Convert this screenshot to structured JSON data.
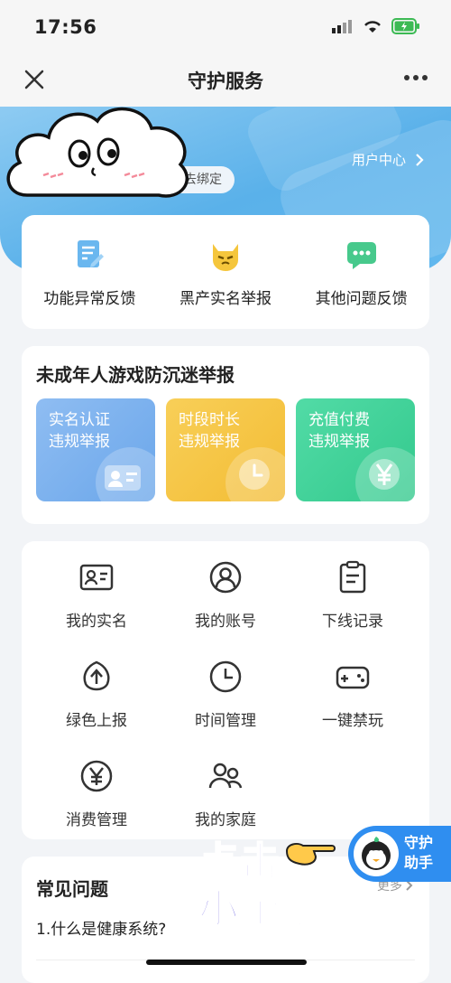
{
  "status": {
    "time": "17:56"
  },
  "nav": {
    "title": "守护服务"
  },
  "banner": {
    "user_center": "用户中心",
    "bind_label": "去绑定"
  },
  "feedback": [
    {
      "label": "功能异常反馈",
      "icon": "doc-edit-icon"
    },
    {
      "label": "黑产实名举报",
      "icon": "cat-face-icon"
    },
    {
      "label": "其他问题反馈",
      "icon": "chat-bubble-icon"
    }
  ],
  "minor": {
    "title": "未成年人游戏防沉迷举报",
    "tiles": [
      {
        "line1": "实名认证",
        "line2": "违规举报",
        "color": "#7fb3ee"
      },
      {
        "line1": "时段时长",
        "line2": "违规举报",
        "color": "#f6c54a"
      },
      {
        "line1": "充值付费",
        "line2": "违规举报",
        "color": "#3fd39a"
      }
    ]
  },
  "grid": [
    {
      "label": "我的实名",
      "icon": "id-card-icon"
    },
    {
      "label": "我的账号",
      "icon": "user-circle-icon"
    },
    {
      "label": "下线记录",
      "icon": "clipboard-icon"
    },
    {
      "label": "绿色上报",
      "icon": "upload-shield-icon"
    },
    {
      "label": "时间管理",
      "icon": "clock-icon"
    },
    {
      "label": "一键禁玩",
      "icon": "gamepad-icon"
    },
    {
      "label": "消费管理",
      "icon": "yen-icon"
    },
    {
      "label": "我的家庭",
      "icon": "family-icon"
    }
  ],
  "faq": {
    "title": "常见问题",
    "more": "更多",
    "q1": "1.什么是健康系统?"
  },
  "promo": {
    "line1": "点击",
    "line2": "小企鹅"
  },
  "assistant": {
    "line1": "守护",
    "line2": "助手"
  }
}
